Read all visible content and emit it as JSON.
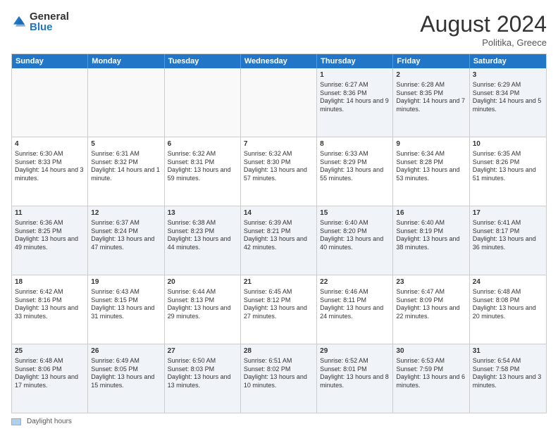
{
  "logo": {
    "general": "General",
    "blue": "Blue"
  },
  "header": {
    "month": "August 2024",
    "location": "Politika, Greece"
  },
  "weekdays": [
    "Sunday",
    "Monday",
    "Tuesday",
    "Wednesday",
    "Thursday",
    "Friday",
    "Saturday"
  ],
  "legend": {
    "box_label": "Daylight hours"
  },
  "weeks": [
    [
      {
        "day": "",
        "text": "",
        "empty": true
      },
      {
        "day": "",
        "text": "",
        "empty": true
      },
      {
        "day": "",
        "text": "",
        "empty": true
      },
      {
        "day": "",
        "text": "",
        "empty": true
      },
      {
        "day": "1",
        "text": "Sunrise: 6:27 AM\nSunset: 8:36 PM\nDaylight: 14 hours\nand 9 minutes.",
        "empty": false
      },
      {
        "day": "2",
        "text": "Sunrise: 6:28 AM\nSunset: 8:35 PM\nDaylight: 14 hours\nand 7 minutes.",
        "empty": false
      },
      {
        "day": "3",
        "text": "Sunrise: 6:29 AM\nSunset: 8:34 PM\nDaylight: 14 hours\nand 5 minutes.",
        "empty": false
      }
    ],
    [
      {
        "day": "4",
        "text": "Sunrise: 6:30 AM\nSunset: 8:33 PM\nDaylight: 14 hours\nand 3 minutes.",
        "empty": false
      },
      {
        "day": "5",
        "text": "Sunrise: 6:31 AM\nSunset: 8:32 PM\nDaylight: 14 hours\nand 1 minute.",
        "empty": false
      },
      {
        "day": "6",
        "text": "Sunrise: 6:32 AM\nSunset: 8:31 PM\nDaylight: 13 hours\nand 59 minutes.",
        "empty": false
      },
      {
        "day": "7",
        "text": "Sunrise: 6:32 AM\nSunset: 8:30 PM\nDaylight: 13 hours\nand 57 minutes.",
        "empty": false
      },
      {
        "day": "8",
        "text": "Sunrise: 6:33 AM\nSunset: 8:29 PM\nDaylight: 13 hours\nand 55 minutes.",
        "empty": false
      },
      {
        "day": "9",
        "text": "Sunrise: 6:34 AM\nSunset: 8:28 PM\nDaylight: 13 hours\nand 53 minutes.",
        "empty": false
      },
      {
        "day": "10",
        "text": "Sunrise: 6:35 AM\nSunset: 8:26 PM\nDaylight: 13 hours\nand 51 minutes.",
        "empty": false
      }
    ],
    [
      {
        "day": "11",
        "text": "Sunrise: 6:36 AM\nSunset: 8:25 PM\nDaylight: 13 hours\nand 49 minutes.",
        "empty": false
      },
      {
        "day": "12",
        "text": "Sunrise: 6:37 AM\nSunset: 8:24 PM\nDaylight: 13 hours\nand 47 minutes.",
        "empty": false
      },
      {
        "day": "13",
        "text": "Sunrise: 6:38 AM\nSunset: 8:23 PM\nDaylight: 13 hours\nand 44 minutes.",
        "empty": false
      },
      {
        "day": "14",
        "text": "Sunrise: 6:39 AM\nSunset: 8:21 PM\nDaylight: 13 hours\nand 42 minutes.",
        "empty": false
      },
      {
        "day": "15",
        "text": "Sunrise: 6:40 AM\nSunset: 8:20 PM\nDaylight: 13 hours\nand 40 minutes.",
        "empty": false
      },
      {
        "day": "16",
        "text": "Sunrise: 6:40 AM\nSunset: 8:19 PM\nDaylight: 13 hours\nand 38 minutes.",
        "empty": false
      },
      {
        "day": "17",
        "text": "Sunrise: 6:41 AM\nSunset: 8:17 PM\nDaylight: 13 hours\nand 36 minutes.",
        "empty": false
      }
    ],
    [
      {
        "day": "18",
        "text": "Sunrise: 6:42 AM\nSunset: 8:16 PM\nDaylight: 13 hours\nand 33 minutes.",
        "empty": false
      },
      {
        "day": "19",
        "text": "Sunrise: 6:43 AM\nSunset: 8:15 PM\nDaylight: 13 hours\nand 31 minutes.",
        "empty": false
      },
      {
        "day": "20",
        "text": "Sunrise: 6:44 AM\nSunset: 8:13 PM\nDaylight: 13 hours\nand 29 minutes.",
        "empty": false
      },
      {
        "day": "21",
        "text": "Sunrise: 6:45 AM\nSunset: 8:12 PM\nDaylight: 13 hours\nand 27 minutes.",
        "empty": false
      },
      {
        "day": "22",
        "text": "Sunrise: 6:46 AM\nSunset: 8:11 PM\nDaylight: 13 hours\nand 24 minutes.",
        "empty": false
      },
      {
        "day": "23",
        "text": "Sunrise: 6:47 AM\nSunset: 8:09 PM\nDaylight: 13 hours\nand 22 minutes.",
        "empty": false
      },
      {
        "day": "24",
        "text": "Sunrise: 6:48 AM\nSunset: 8:08 PM\nDaylight: 13 hours\nand 20 minutes.",
        "empty": false
      }
    ],
    [
      {
        "day": "25",
        "text": "Sunrise: 6:48 AM\nSunset: 8:06 PM\nDaylight: 13 hours\nand 17 minutes.",
        "empty": false
      },
      {
        "day": "26",
        "text": "Sunrise: 6:49 AM\nSunset: 8:05 PM\nDaylight: 13 hours\nand 15 minutes.",
        "empty": false
      },
      {
        "day": "27",
        "text": "Sunrise: 6:50 AM\nSunset: 8:03 PM\nDaylight: 13 hours\nand 13 minutes.",
        "empty": false
      },
      {
        "day": "28",
        "text": "Sunrise: 6:51 AM\nSunset: 8:02 PM\nDaylight: 13 hours\nand 10 minutes.",
        "empty": false
      },
      {
        "day": "29",
        "text": "Sunrise: 6:52 AM\nSunset: 8:01 PM\nDaylight: 13 hours\nand 8 minutes.",
        "empty": false
      },
      {
        "day": "30",
        "text": "Sunrise: 6:53 AM\nSunset: 7:59 PM\nDaylight: 13 hours\nand 6 minutes.",
        "empty": false
      },
      {
        "day": "31",
        "text": "Sunrise: 6:54 AM\nSunset: 7:58 PM\nDaylight: 13 hours\nand 3 minutes.",
        "empty": false
      }
    ]
  ]
}
